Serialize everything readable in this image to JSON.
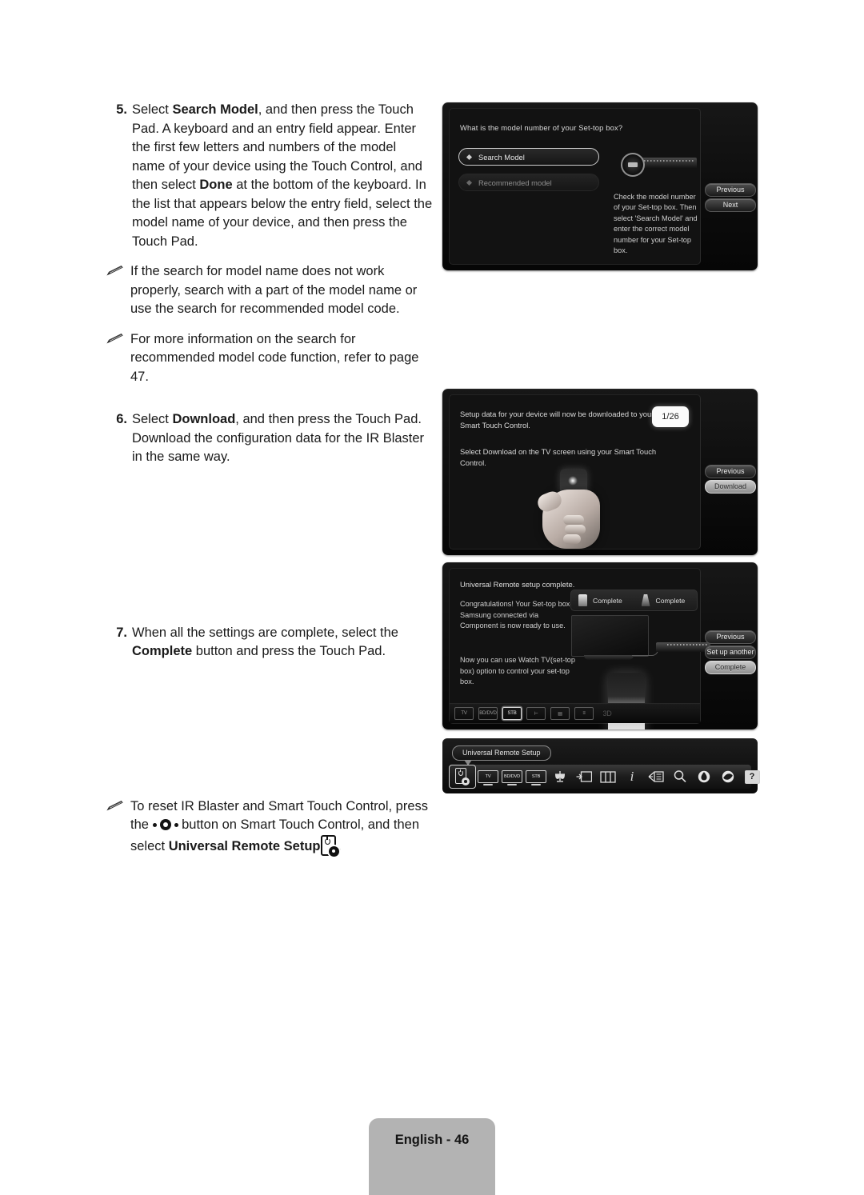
{
  "document": {
    "footer_label": "English - 46"
  },
  "instructions": {
    "step5": {
      "number": "5.",
      "pre": "Select ",
      "bold1": "Search Model",
      "mid1": ", and then press the Touch Pad. A keyboard and an entry field appear. Enter the first few letters and numbers of the model name of your device using the Touch Control, and then select ",
      "bold2": "Done",
      "tail": " at the bottom of the keyboard. In the list that appears below the entry field, select the model name of your device, and then press the Touch Pad."
    },
    "note1": "If the search for model name does not work properly, search with a part of the model name or use the search for recommended model code.",
    "note2": "For more information on the search for recommended model code function, refer to page 47.",
    "step6": {
      "number": "6.",
      "pre": "Select ",
      "bold1": "Download",
      "tail": ", and then press the Touch Pad. Download the configuration data for the IR Blaster in the same way."
    },
    "step7": {
      "number": "7.",
      "pre": "When all the settings are complete, select the ",
      "bold1": "Complete",
      "tail": " button and press the Touch Pad."
    },
    "note3": {
      "pre": "To reset IR Blaster and Smart Touch Control, press the ",
      "mid": " button on Smart Touch Control, and then select ",
      "bold1": "Universal Remote Setup",
      "tail": "."
    }
  },
  "panel_search": {
    "question": "What is the model number of your Set-top box?",
    "options": [
      {
        "label": "Search Model",
        "selected": true
      },
      {
        "label": "Recommended model",
        "selected": false
      }
    ],
    "help_text": "Check the model number of your Set-top box. Then select 'Search Model' and enter the correct model number for your Set-top box.",
    "buttons": [
      {
        "label": "Previous",
        "style": "dark"
      },
      {
        "label": "Next",
        "style": "dark"
      }
    ]
  },
  "panel_download": {
    "text1": "Setup data for your device will now be downloaded to your Smart Touch Control.",
    "text2": "Select Download on the TV screen using your Smart Touch Control.",
    "badge": "1/26",
    "buttons": [
      {
        "label": "Previous",
        "style": "dark"
      },
      {
        "label": "Download",
        "style": "light"
      }
    ]
  },
  "panel_complete": {
    "title": "Universal Remote setup complete.",
    "paragraph1": "Congratulations! Your Set-top box-Samsung connected via Component is now ready to use.",
    "paragraph2": "Now you can use Watch TV(set-top box) option to control your set-top box.",
    "chips": [
      {
        "label": "Complete",
        "icon": "remote-icon"
      },
      {
        "label": "Complete",
        "icon": "ir-blaster-icon"
      }
    ],
    "source_icons": [
      {
        "label": "TV",
        "selected": false
      },
      {
        "label": "BD/DVD",
        "selected": false
      },
      {
        "label": "STB",
        "selected": true
      },
      {
        "label": "source-icon",
        "selected": false
      },
      {
        "label": "channel-list-icon",
        "selected": false
      },
      {
        "label": "guide-icon",
        "selected": false
      },
      {
        "label": "3D",
        "selected": false
      }
    ],
    "buttons": [
      {
        "label": "Previous",
        "style": "dark"
      },
      {
        "label": "Set up another",
        "style": "dark"
      },
      {
        "label": "Complete",
        "style": "light"
      }
    ]
  },
  "panel_toolbar": {
    "tooltip": "Universal Remote Setup",
    "items": [
      {
        "name": "universal-remote-setup-icon",
        "label": "",
        "selected": true
      },
      {
        "name": "tv-icon",
        "label": "TV",
        "selected": false
      },
      {
        "name": "bd-dvd-icon",
        "label": "BD/DVD",
        "selected": false
      },
      {
        "name": "stb-icon",
        "label": "STB",
        "selected": false
      },
      {
        "name": "speaker-icon",
        "label": "",
        "selected": false
      },
      {
        "name": "source-icon",
        "label": "",
        "selected": false
      },
      {
        "name": "channel-list-icon",
        "label": "",
        "selected": false
      },
      {
        "name": "info-icon",
        "label": "i",
        "selected": false
      },
      {
        "name": "guide-icon",
        "label": "",
        "selected": false
      },
      {
        "name": "search-icon",
        "label": "",
        "selected": false
      },
      {
        "name": "smart-hub-icon",
        "label": "",
        "selected": false
      },
      {
        "name": "apps-icon",
        "label": "",
        "selected": false
      },
      {
        "name": "help-icon",
        "label": "?",
        "selected": false
      }
    ]
  }
}
